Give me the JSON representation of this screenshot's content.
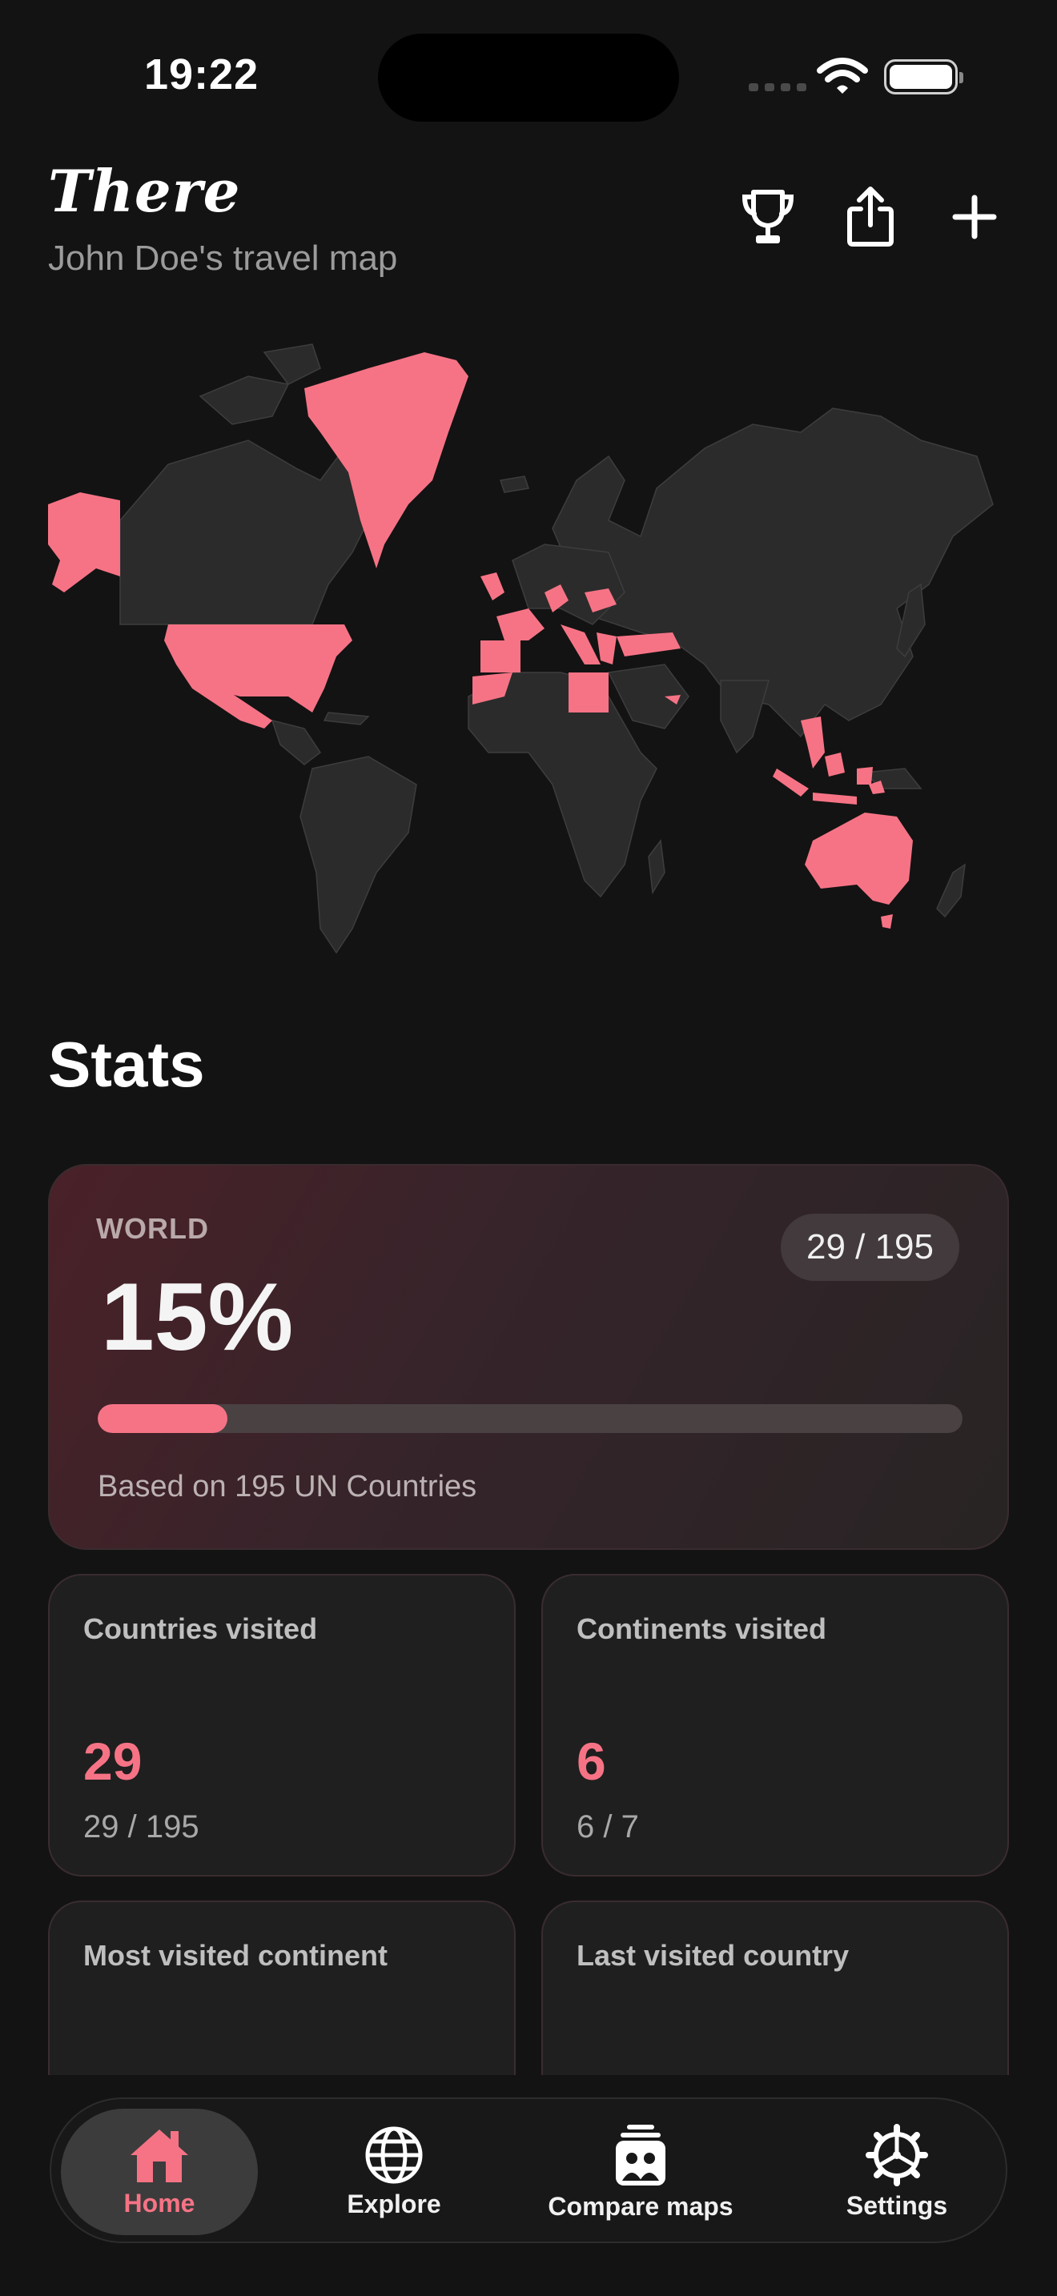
{
  "status_bar": {
    "time": "19:22"
  },
  "header": {
    "title": "There",
    "subtitle": "John Doe's travel map",
    "icons": [
      "trophy-icon",
      "share-icon",
      "plus-icon"
    ]
  },
  "colors": {
    "accent": "#f67385",
    "background": "#131313",
    "card": "#1f1f1f",
    "map_unvisited": "#2b2b2b"
  },
  "stats": {
    "section_title": "Stats",
    "world": {
      "label": "WORLD",
      "percent": "15%",
      "ratio": "29 / 195",
      "progress": 0.15,
      "note": "Based on 195 UN Countries"
    },
    "cards": [
      {
        "title": "Countries visited",
        "value": "29",
        "sub": "29 / 195"
      },
      {
        "title": "Continents visited",
        "value": "6",
        "sub": "6 / 7"
      },
      {
        "title": "Most visited continent",
        "value": "",
        "sub": ""
      },
      {
        "title": "Last visited country",
        "value": "",
        "sub": ""
      }
    ]
  },
  "nav": [
    {
      "label": "Home",
      "icon": "home-icon",
      "active": true
    },
    {
      "label": "Explore",
      "icon": "globe-icon",
      "active": false
    },
    {
      "label": "Compare maps",
      "icon": "compare-maps-icon",
      "active": false
    },
    {
      "label": "Settings",
      "icon": "settings-icon",
      "active": false
    }
  ]
}
